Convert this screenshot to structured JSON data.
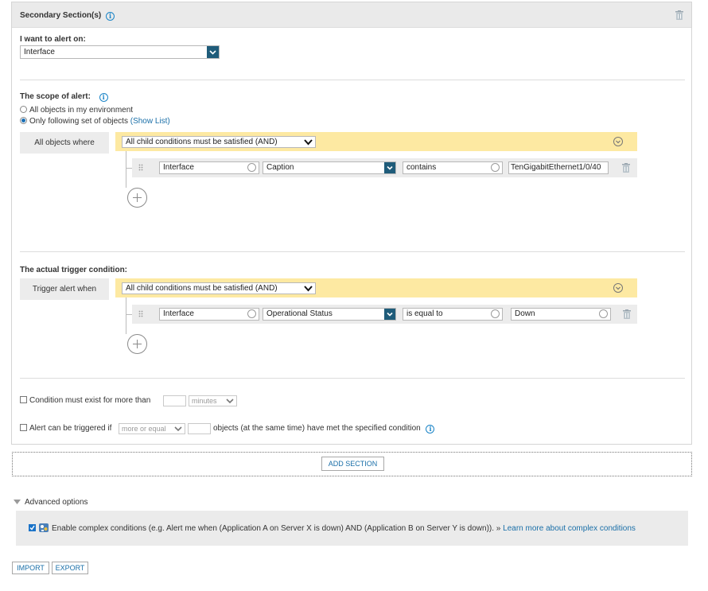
{
  "section": {
    "title": "Secondary Section(s)",
    "alert_on_label": "I want to alert on:",
    "alert_on_value": "Interface"
  },
  "scope": {
    "title": "The scope of alert:",
    "option_all": "All objects in my environment",
    "option_following": "Only following set of objects",
    "show_list": "(Show List)",
    "selected_option": "Only following set of objects",
    "group_label": "All objects where",
    "group_operator": "All child conditions must be satisfied (AND)",
    "condition": {
      "object": "Interface",
      "field": "Caption",
      "operator": "contains",
      "value": "TenGigabitEthernet1/0/40"
    }
  },
  "trigger": {
    "title": "The actual trigger condition:",
    "group_label": "Trigger alert when",
    "group_operator": "All child conditions must be satisfied (AND)",
    "condition": {
      "object": "Interface",
      "field": "Operational Status",
      "operator": "is equal to",
      "value": "Down"
    }
  },
  "options": {
    "exist_label": "Condition must exist for more than",
    "exist_unit": "minutes",
    "exist_checked": false,
    "count_prefix": "Alert can be triggered if",
    "count_mode": "more or equal",
    "count_suffix": "objects (at the same time) have met the specified condition",
    "count_checked": false
  },
  "add_section_label": "ADD SECTION",
  "advanced": {
    "title": "Advanced options",
    "complex_checked": true,
    "complex_text": "Enable complex conditions (e.g. Alert me when (Application A on Server X is down) AND (Application B on Server Y is down)). »",
    "learn_more": "Learn more about complex conditions"
  },
  "footer": {
    "import_label": "IMPORT",
    "export_label": "EXPORT"
  },
  "icons": {
    "info": "info-icon",
    "trash": "trash-icon",
    "plus": "plus-icon",
    "drag": "drag-handle-icon",
    "chevron": "chevron-down-icon"
  },
  "colors": {
    "accent": "#1f5c7a",
    "link": "#1a6fa8",
    "group_bar": "#fde9a2",
    "header_bg": "#eaeaea"
  }
}
